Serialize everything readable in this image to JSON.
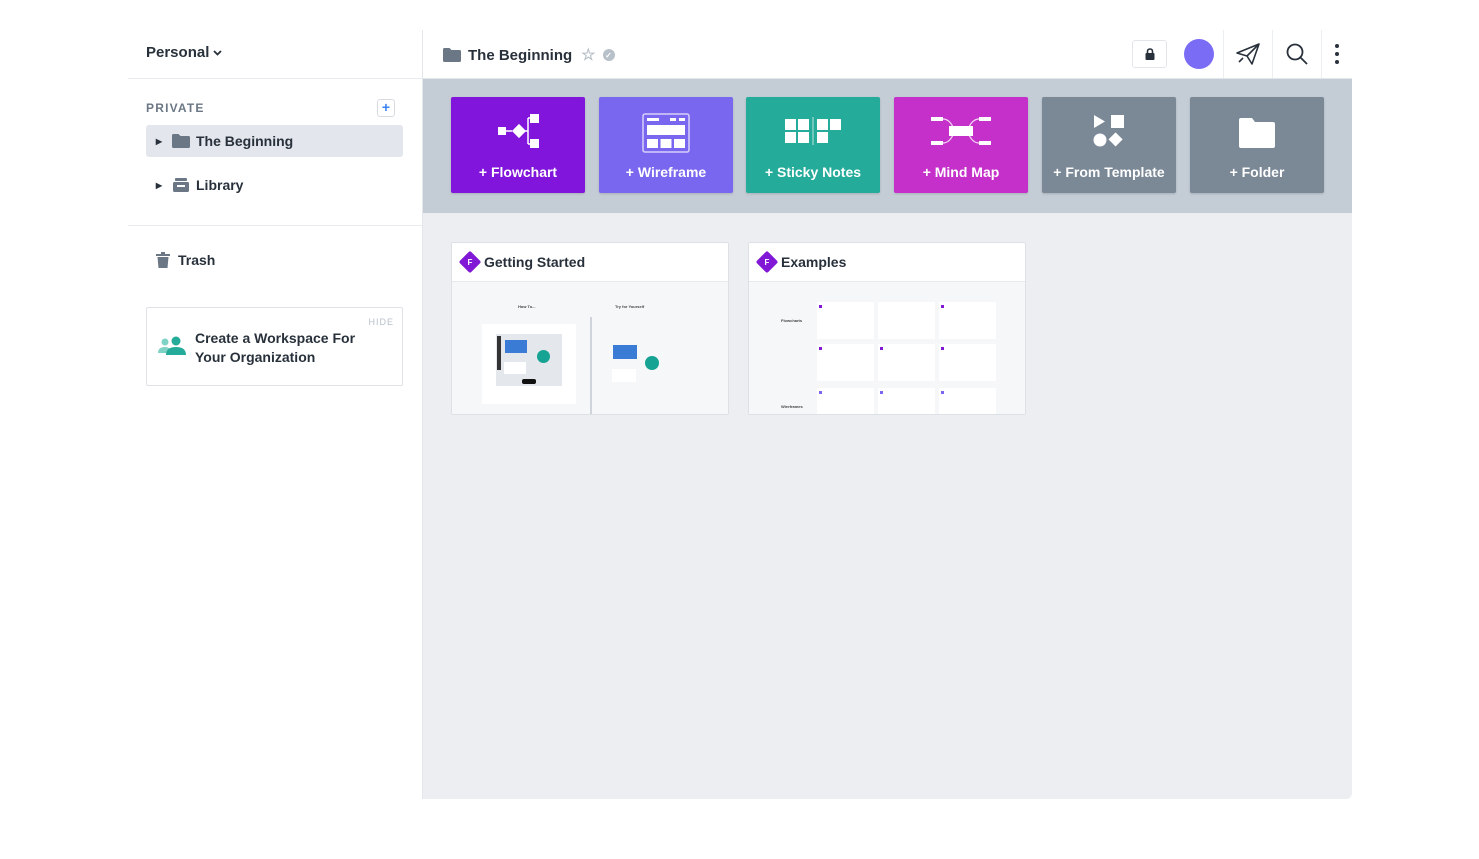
{
  "sidebar": {
    "workspace": "Personal",
    "section_header": "PRIVATE",
    "add_label": "+",
    "items": [
      {
        "label": "The Beginning",
        "icon": "folder-icon"
      },
      {
        "label": "Library",
        "icon": "library-icon"
      }
    ],
    "trash_label": "Trash",
    "promo": {
      "hide_label": "HIDE",
      "text": "Create a Workspace For Your Organization"
    }
  },
  "header": {
    "breadcrumb": "The Beginning",
    "icons": [
      "folder-icon",
      "star-icon",
      "check-icon",
      "lock-icon",
      "avatar",
      "send-icon",
      "search-icon",
      "more-icon"
    ]
  },
  "create_tiles": [
    {
      "label": "+ Flowchart",
      "color": "#8115db",
      "icon": "flowchart-icon"
    },
    {
      "label": "+ Wireframe",
      "color": "#7967ef",
      "icon": "wireframe-icon"
    },
    {
      "label": "+ Sticky Notes",
      "color": "#24ab99",
      "icon": "sticky-notes-icon"
    },
    {
      "label": "+ Mind Map",
      "color": "#c430c9",
      "icon": "mind-map-icon"
    },
    {
      "label": "+ From Template",
      "color": "#7b8896",
      "icon": "template-icon"
    },
    {
      "label": "+ Folder",
      "color": "#7b8896",
      "icon": "folder-icon"
    }
  ],
  "documents": [
    {
      "title": "Getting Started",
      "badge": "F",
      "thumb_labels": [
        "How To...",
        "Try for Yourself"
      ]
    },
    {
      "title": "Examples",
      "badge": "F",
      "thumb_labels": [
        "Flowcharts",
        "Wireframes"
      ]
    }
  ]
}
